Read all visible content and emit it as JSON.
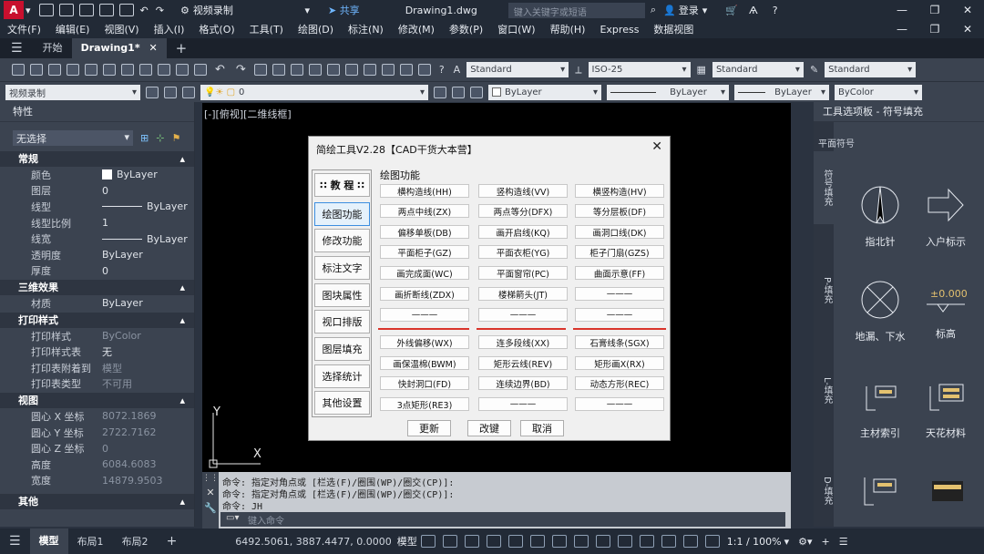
{
  "title_bar": {
    "logo": "A",
    "workspace": "视频录制",
    "share": "共享",
    "document": "Drawing1.dwg",
    "search_placeholder": "键入关键字或短语",
    "login": "登录"
  },
  "menu": [
    "文件(F)",
    "编辑(E)",
    "视图(V)",
    "插入(I)",
    "格式(O)",
    "工具(T)",
    "绘图(D)",
    "标注(N)",
    "修改(M)",
    "参数(P)",
    "窗口(W)",
    "帮助(H)",
    "Express",
    "数据视图"
  ],
  "tabs": {
    "start": "开始",
    "active": "Drawing1*"
  },
  "toolbar1": {
    "text_style": "Standard",
    "dim_style": "ISO-25",
    "table_style": "Standard",
    "multileader_style": "Standard"
  },
  "toolbar2": {
    "workspace": "视频录制",
    "layer": "0",
    "color": "ByLayer",
    "linetype": "ByLayer",
    "lineweight": "ByLayer",
    "plotstyle": "ByColor"
  },
  "properties": {
    "header": "特性",
    "selection": "无选择",
    "sections": [
      {
        "title": "常规",
        "rows": [
          {
            "k": "颜色",
            "v": "ByLayer"
          },
          {
            "k": "图层",
            "v": "0"
          },
          {
            "k": "线型",
            "v": "ByLayer"
          },
          {
            "k": "线型比例",
            "v": "1"
          },
          {
            "k": "线宽",
            "v": "ByLayer"
          },
          {
            "k": "透明度",
            "v": "ByLayer"
          },
          {
            "k": "厚度",
            "v": "0"
          }
        ]
      },
      {
        "title": "三维效果",
        "rows": [
          {
            "k": "材质",
            "v": "ByLayer"
          }
        ]
      },
      {
        "title": "打印样式",
        "rows": [
          {
            "k": "打印样式",
            "v": "ByColor"
          },
          {
            "k": "打印样式表",
            "v": "无"
          },
          {
            "k": "打印表附着到",
            "v": "模型"
          },
          {
            "k": "打印表类型",
            "v": "不可用"
          }
        ]
      },
      {
        "title": "视图",
        "rows": [
          {
            "k": "圆心 X 坐标",
            "v": "8072.1869"
          },
          {
            "k": "圆心 Y 坐标",
            "v": "2722.7162"
          },
          {
            "k": "圆心 Z 坐标",
            "v": "0"
          },
          {
            "k": "高度",
            "v": "6084.6083"
          },
          {
            "k": "宽度",
            "v": "14879.9503"
          }
        ]
      },
      {
        "title": "其他",
        "rows": []
      }
    ]
  },
  "canvas": {
    "view_label": "[-][俯视][二维线框]",
    "axis_y": "Y",
    "axis_x": "X"
  },
  "command": {
    "lines": [
      "命令: 指定对角点或 [栏选(F)/圈围(WP)/圈交(CP)]:",
      "命令: 指定对角点或 [栏选(F)/圈围(WP)/圈交(CP)]:",
      "命令: JH"
    ],
    "placeholder": "键入命令"
  },
  "palette": {
    "header": "工具选项板 - 符号填充",
    "section": "平面符号",
    "vtabs": [
      "符号填充",
      "P-填充",
      "L-填充",
      "D-填充"
    ],
    "items": [
      "指北针",
      "入户标示",
      "地漏、下水",
      "标高",
      "主材索引",
      "天花材料"
    ],
    "elevation": "±0.000"
  },
  "status": {
    "model_tab": "模型",
    "layout1": "布局1",
    "layout2": "布局2",
    "coords": "6492.5061, 3887.4477, 0.0000",
    "mode": "模型",
    "scale": "1:1 / 100%"
  },
  "dialog": {
    "title": "简绘工具V2.28【CAD干货大本营】",
    "side": [
      "∷ 教 程 ∷",
      "绘图功能",
      "修改功能",
      "标注文字",
      "图块属性",
      "视口排版",
      "图层填充",
      "选择统计",
      "其他设置"
    ],
    "group_label": "绘图功能",
    "rows": [
      [
        "横构造线(HH)",
        "竖构造线(VV)",
        "横竖构造(HV)"
      ],
      [
        "两点中线(ZX)",
        "两点等分(DFX)",
        "等分层板(DF)"
      ],
      [
        "偏移单板(DB)",
        "画开启线(KQ)",
        "画洞口线(DK)"
      ],
      [
        "平面柜子(GZ)",
        "平面衣柜(YG)",
        "柜子门扇(GZS)"
      ],
      [
        "画完成面(WC)",
        "平面窗帘(PC)",
        "曲面示意(FF)"
      ],
      [
        "画折断线(ZDX)",
        "楼梯箭头(JT)",
        "———"
      ],
      [
        "———",
        "———",
        "———"
      ],
      [
        "外线偏移(WX)",
        "连多段线(XX)",
        "石膏线条(SGX)"
      ],
      [
        "画保温棉(BWM)",
        "矩形云线(REV)",
        "矩形画X(RX)"
      ],
      [
        "快封洞口(FD)",
        "连续边界(BD)",
        "动态方形(REC)"
      ],
      [
        "3点矩形(RE3)",
        "———",
        "———"
      ]
    ],
    "buttons": {
      "update": "更新",
      "improve": "改键",
      "cancel": "取消"
    }
  }
}
